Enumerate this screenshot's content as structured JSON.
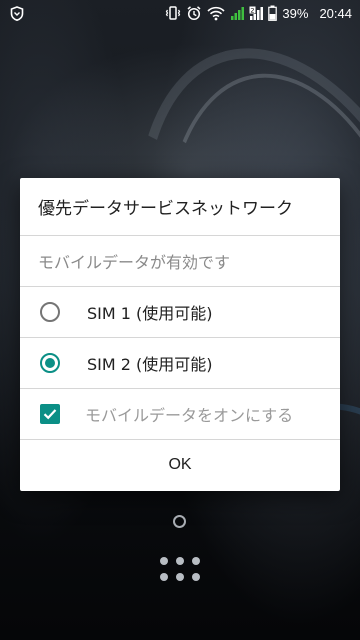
{
  "statusbar": {
    "battery_percent": "39%",
    "time": "20:44",
    "sim_indicator": "2"
  },
  "dialog": {
    "title": "優先データサービスネットワーク",
    "subtitle": "モバイルデータが有効です",
    "options": [
      {
        "label": "SIM 1 (使用可能)",
        "selected": false
      },
      {
        "label": "SIM 2 (使用可能)",
        "selected": true
      }
    ],
    "mobile_data_toggle": {
      "label": "モバイルデータをオンにする",
      "checked": true
    },
    "ok_label": "OK"
  },
  "colors": {
    "accent": "#0b8f86",
    "dialog_background": "#ffffff",
    "subtitle_text": "#8a8a8a"
  }
}
